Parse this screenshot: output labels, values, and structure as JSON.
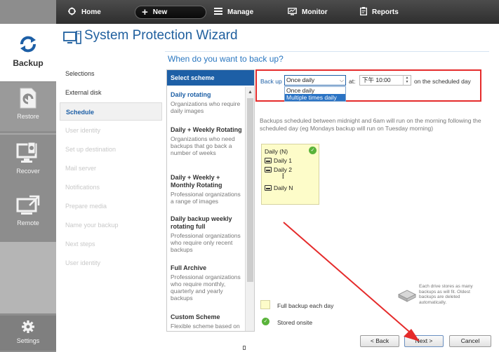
{
  "toolbar": {
    "home": "Home",
    "new": "New",
    "manage": "Manage",
    "monitor": "Monitor",
    "reports": "Reports"
  },
  "sidebar": {
    "backup": "Backup",
    "restore": "Restore",
    "recover": "Recover",
    "remote": "Remote",
    "settings": "Settings"
  },
  "wizard": {
    "title": "System Protection Wizard",
    "question": "When do you want to back up?"
  },
  "steps": [
    {
      "label": "Selections",
      "state": "done"
    },
    {
      "label": "External disk",
      "state": "done"
    },
    {
      "label": "Schedule",
      "state": "active"
    },
    {
      "label": "User identity",
      "state": "disabled"
    },
    {
      "label": "Set up destination",
      "state": "disabled"
    },
    {
      "label": "Mail server",
      "state": "disabled"
    },
    {
      "label": "Notifications",
      "state": "disabled"
    },
    {
      "label": "Prepare media",
      "state": "disabled"
    },
    {
      "label": "Name your backup",
      "state": "disabled"
    },
    {
      "label": "Next steps",
      "state": "disabled"
    },
    {
      "label": "User identity",
      "state": "disabled"
    }
  ],
  "schemes": {
    "header": "Select scheme",
    "items": [
      {
        "name": "Daily rotating",
        "desc": "Organizations who require daily images"
      },
      {
        "name": "Daily + Weekly Rotating",
        "desc": "Organizations who need backups that go back a number of weeks"
      },
      {
        "name": "Daily + Weekly + Monthly Rotating",
        "desc": "Professional organizations a range of images"
      },
      {
        "name": "Daily backup weekly rotating full",
        "desc": "Professional organizations who require only recent backups"
      },
      {
        "name": "Full Archive",
        "desc": "Professional organizations who require monthly, quarterly and yearly backups"
      },
      {
        "name": "Custom Scheme",
        "desc": "Flexible scheme based on"
      }
    ]
  },
  "schedule": {
    "backup_label": "Back up",
    "frequency_value": "Once daily",
    "frequency_options": [
      "Once daily",
      "Multiple times daily"
    ],
    "at_label": "at:",
    "time_value": "下午 10:00",
    "suffix": "on the scheduled day",
    "note": "Backups scheduled between midnight and 6am will run on the morning following the scheduled day (eg Mondays backup will run on Tuesday morning)"
  },
  "rotation": {
    "title": "Daily (N)",
    "day1": "Daily 1",
    "day2": "Daily 2",
    "dots": "⋮",
    "dayn": "Daily N"
  },
  "legend": {
    "full": "Full backup each day",
    "onsite": "Stored onsite",
    "drive_note": "Each drive stores as many backups as will fit. Oldest backups are deleted automatically."
  },
  "buttons": {
    "back": "< Back",
    "next": "Next >",
    "cancel": "Cancel"
  },
  "colors": {
    "accent": "#1d5fa6",
    "highlight_box": "#e52b2b",
    "annotation_arrow": "#e52b2b",
    "onsite_green": "#59b33a",
    "full_backup_yellow": "#fdfcc9"
  }
}
